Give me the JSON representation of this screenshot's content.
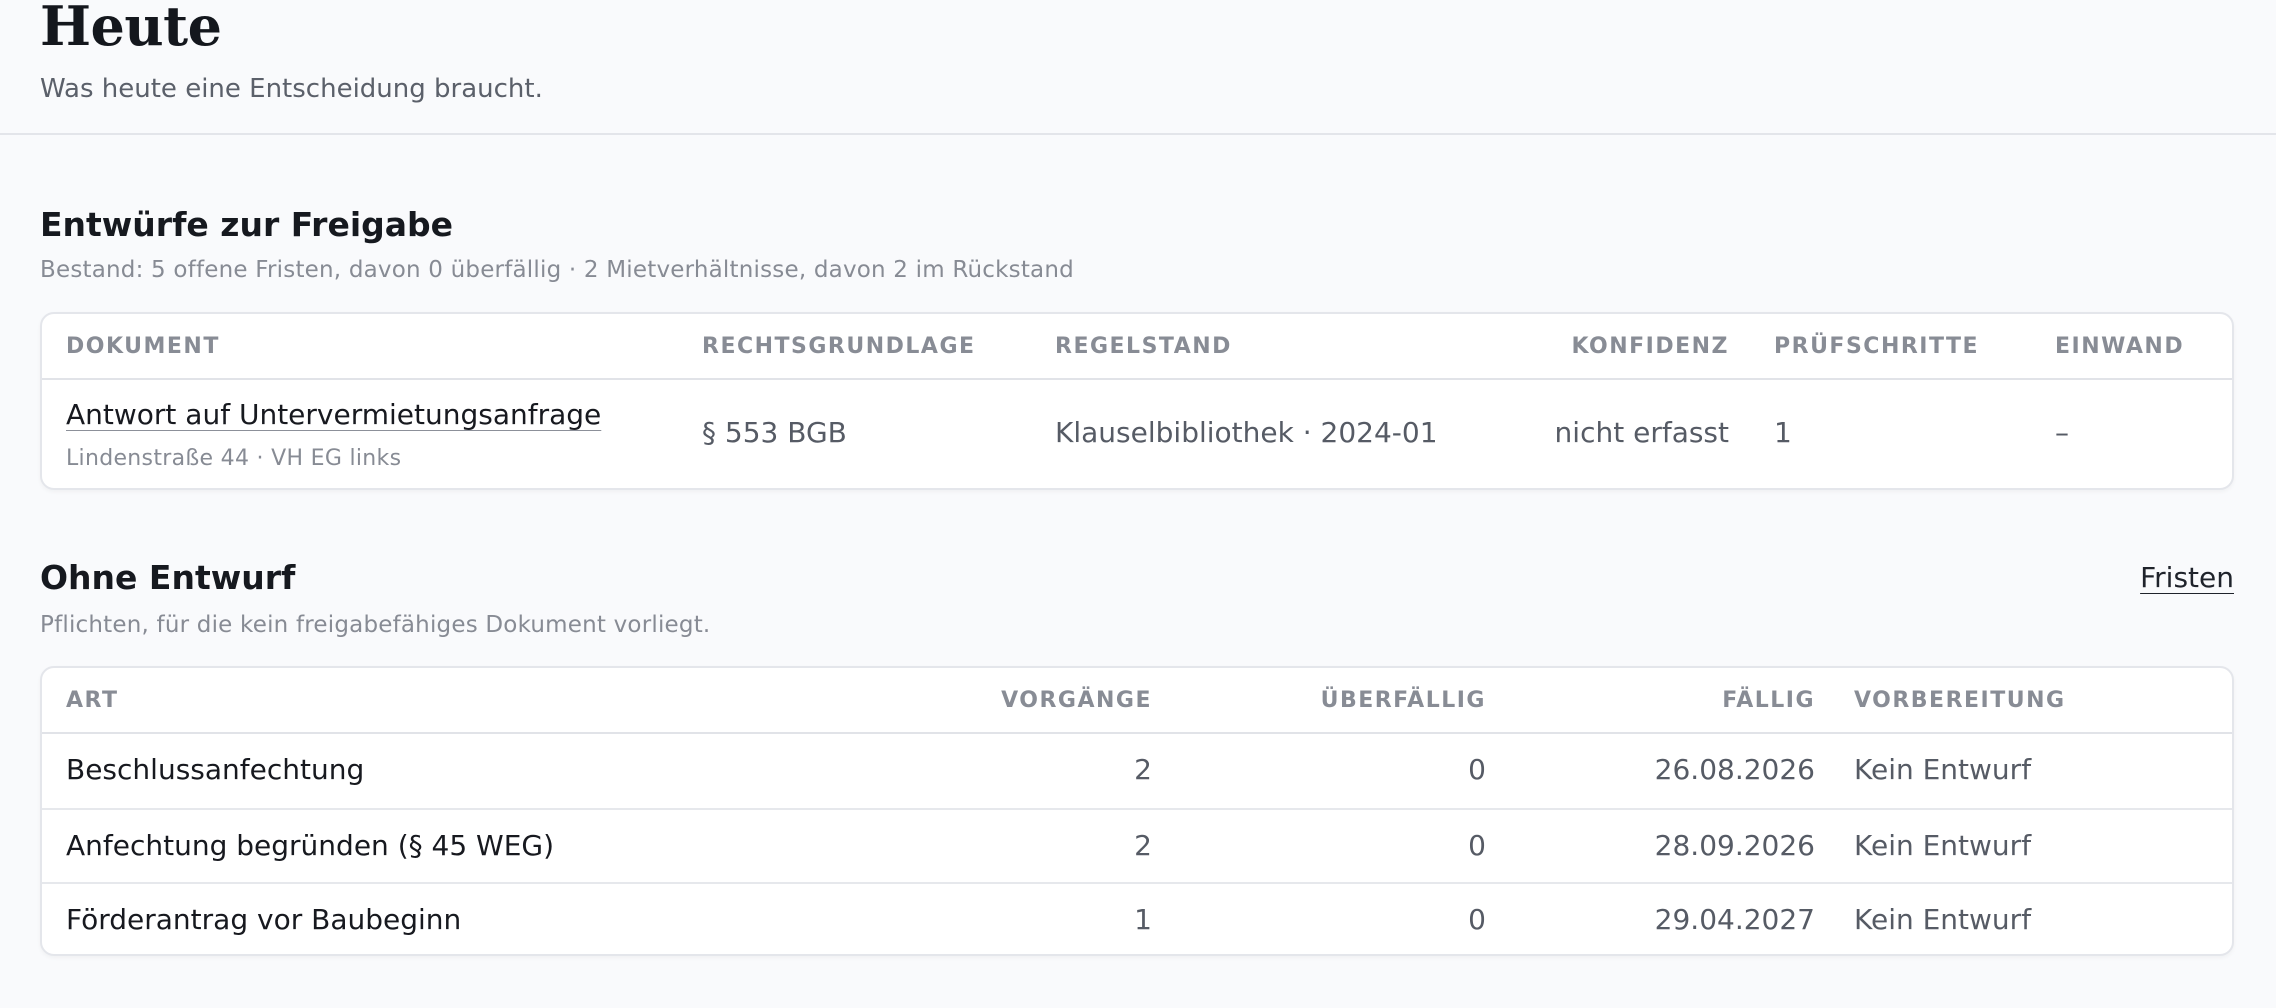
{
  "header": {
    "title": "Heute",
    "subtitle": "Was heute eine Entscheidung braucht."
  },
  "drafts": {
    "title": "Entwürfe zur Freigabe",
    "summary": "Bestand: 5 offene Fristen, davon 0 überfällig · 2 Mietverhältnisse, davon 2 im Rückstand",
    "columns": {
      "document": "DOKUMENT",
      "legal_basis": "RECHTSGRUNDLAGE",
      "rule_version": "REGELSTAND",
      "confidence": "KONFIDENZ",
      "checks": "PRÜFSCHRITTE",
      "objection": "EINWAND"
    },
    "rows": [
      {
        "document": "Antwort auf Untervermietungsanfrage",
        "location": "Lindenstraße 44 · VH EG links",
        "legal_basis": "§ 553 BGB",
        "rule_version": "Klauselbibliothek · 2024-01",
        "confidence": "nicht erfasst",
        "checks": "1",
        "objection": "–"
      }
    ]
  },
  "no_draft": {
    "title": "Ohne Entwurf",
    "link": "Fristen",
    "summary": "Pflichten, für die kein freigabefähiges Dokument vorliegt.",
    "columns": {
      "type": "ART",
      "cases": "VORGÄNGE",
      "overdue": "ÜBERFÄLLIG",
      "due": "FÄLLIG",
      "preparation": "VORBEREITUNG"
    },
    "rows": [
      {
        "type": "Beschlussanfechtung",
        "cases": "2",
        "overdue": "0",
        "due": "26.08.2026",
        "preparation": "Kein Entwurf"
      },
      {
        "type": "Anfechtung begründen (§ 45 WEG)",
        "cases": "2",
        "overdue": "0",
        "due": "28.09.2026",
        "preparation": "Kein Entwurf"
      },
      {
        "type": "Förderantrag vor Baubeginn",
        "cases": "1",
        "overdue": "0",
        "due": "29.04.2027",
        "preparation": "Kein Entwurf"
      }
    ]
  }
}
